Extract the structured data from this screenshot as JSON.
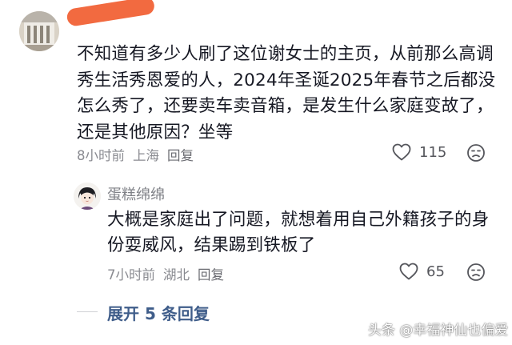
{
  "top_comment": {
    "text": "不知道有多少人刷了这位谢女士的主页，从前那么高调秀生活秀恩爱的人，2024年圣诞2025年春节之后都没怎么秀了，还要卖车卖音箱，是发生什么家庭变故了，还是其他原因？坐等",
    "time": "8小时前",
    "location": "上海",
    "reply_label": "回复",
    "like_count": "115"
  },
  "reply_comment": {
    "author": "蛋糕绵绵",
    "text": "大概是家庭出了问题，就想着用自己外籍孩子的身份耍威风，结果踢到铁板了",
    "time": "7小时前",
    "location": "湖北",
    "reply_label": "回复",
    "like_count": "65"
  },
  "expand_replies": "展开 5 条回复",
  "watermark": "头条 @幸福神仙也偏爱",
  "icons": [
    "heart-icon",
    "dislike-face-icon"
  ],
  "colors": {
    "text_primary": "#161823",
    "text_meta": "#8a8b91",
    "expand_link": "#3f5d8a",
    "redaction": "#f26a40"
  }
}
